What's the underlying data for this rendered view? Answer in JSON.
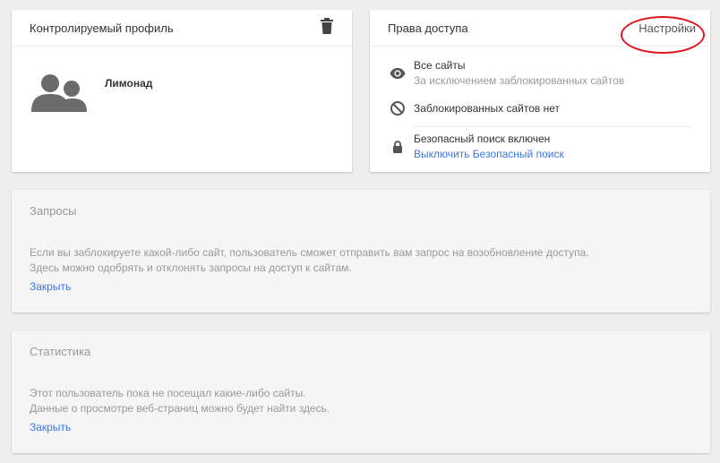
{
  "profile_card": {
    "title": "Контролируемый профиль",
    "name": "Лимонад",
    "icons": {
      "delete": "trash-icon",
      "avatar": "supervised-users-icon"
    }
  },
  "access_card": {
    "title": "Права доступа",
    "settings_label": "Настройки",
    "annotation_color": "#e0161c",
    "items": [
      {
        "icon": "eye-icon",
        "label": "Все сайты",
        "sub": "За исключением заблокированных сайтов"
      },
      {
        "icon": "block-icon",
        "label": "Заблокированных сайтов нет"
      },
      {
        "icon": "lock-icon",
        "label": "Безопасный поиск включен",
        "link": "Выключить Безопасный поиск"
      }
    ]
  },
  "requests_card": {
    "title": "Запросы",
    "text_line1": "Если вы заблокируете какой-либо сайт, пользователь сможет отправить вам запрос на возобновление доступа.",
    "text_line2": "Здесь можно одобрять и отклонять запросы на доступ к сайтам.",
    "close_label": "Закрыть"
  },
  "stats_card": {
    "title": "Статистика",
    "text_line1": "Этот пользователь пока не посещал какие-либо сайты.",
    "text_line2": "Данные о просмотре веб-страниц можно будет найти здесь.",
    "close_label": "Закрыть"
  },
  "colors": {
    "link": "#3b78e7",
    "background": "#eeeeee",
    "muted_text": "#999999"
  }
}
